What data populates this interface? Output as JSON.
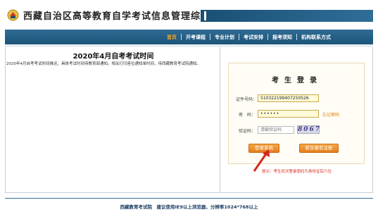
{
  "header": {
    "title": "西藏自治区高等教育自学考试信息管理综合平台"
  },
  "nav": {
    "items": [
      {
        "label": "首页",
        "active": true
      },
      {
        "label": "开考课程"
      },
      {
        "label": "专业计划"
      },
      {
        "label": "考试安排"
      },
      {
        "label": "报考须知"
      },
      {
        "label": "机构联系方式"
      }
    ]
  },
  "notice": {
    "title": "2020年4月自考考试时间",
    "body": "2020年4月自考考试时间推迟，具体考试时间待教育部通知。相关打印座位通知单时间，待西藏教育考试院通知。"
  },
  "login": {
    "title": "考生登录",
    "id_label": "证件号码：",
    "id_value": "510322199407250526",
    "password_label": "密　码：",
    "password_value": "••••••",
    "forgot_label": "忘记密码",
    "captcha_label": "验证码：",
    "captcha_placeholder": "请输验证码",
    "captcha_text": "8067",
    "login_button": "登录系统",
    "register_button": "新生报名注册",
    "hint": "提示：考生初次登录密码为身份证后六位"
  },
  "footer": {
    "text": "西藏教育考试院　建议使用IE9以上浏览器，分辨率1024*768以上"
  },
  "colors": {
    "nav_bg": "#2e6b94",
    "active_nav": "#f5a623",
    "button": "#e37e1c",
    "hint": "#d6271b"
  }
}
